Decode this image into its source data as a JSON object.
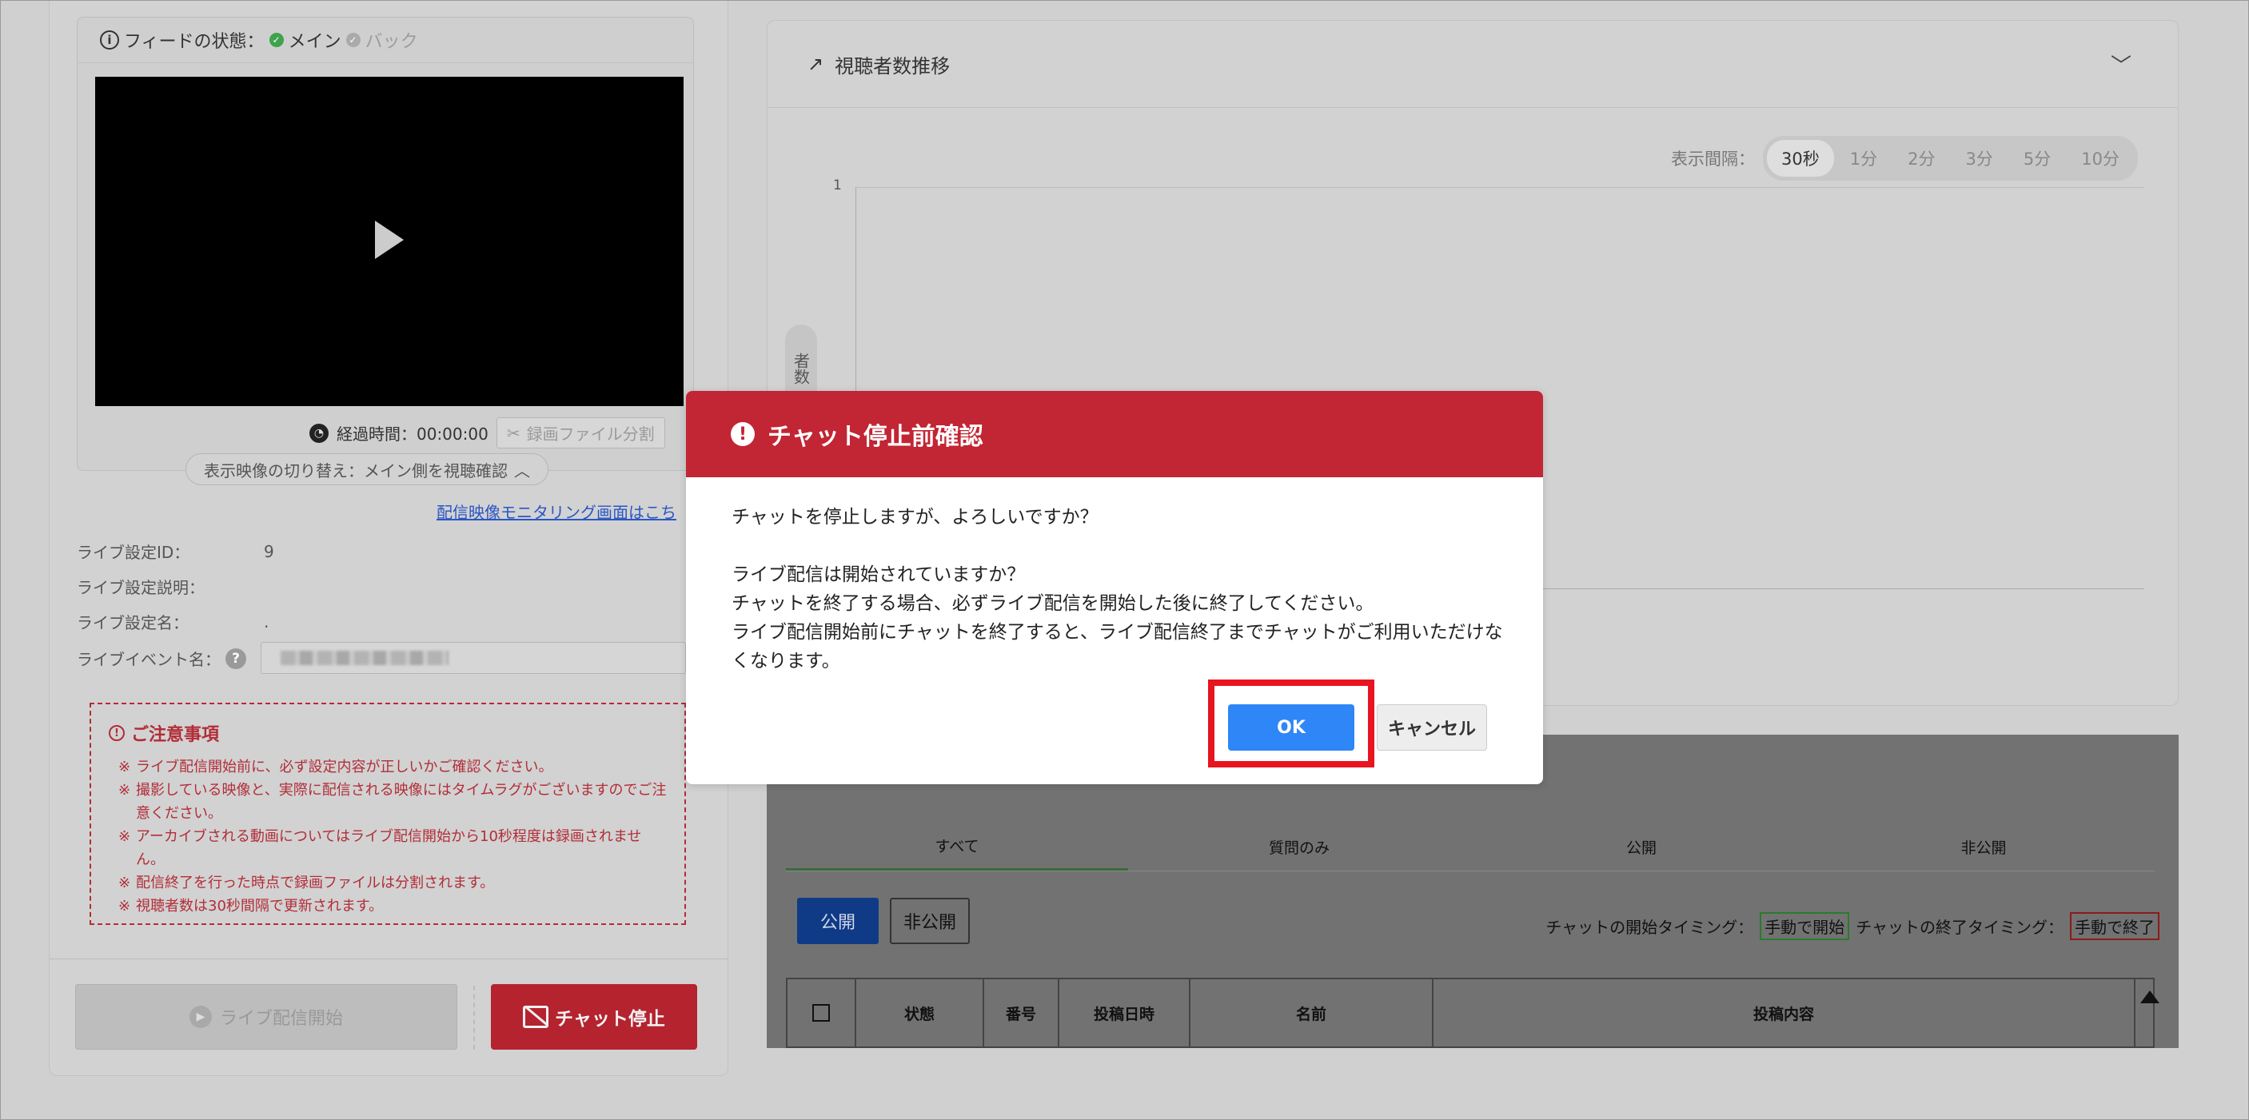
{
  "feed": {
    "label": "フィードの状態：",
    "main": "メイン",
    "backup": "バック",
    "elapsed_label": "経過時間：00:00:00",
    "split_button": "録画ファイル分割",
    "switch_label": "表示映像の切り替え：メイン側を視聴確認",
    "monitor_link": "配信映像モニタリング画面はこち"
  },
  "settings": {
    "id_label": "ライブ設定ID：",
    "id_value": "9",
    "desc_label": "ライブ設定説明：",
    "desc_value": "",
    "name_label": "ライブ設定名：",
    "name_value": ".",
    "event_label": "ライブイベント名："
  },
  "notice": {
    "title": "ご注意事項",
    "items": [
      "ライブ配信開始前に、必ず設定内容が正しいかご確認ください。",
      "撮影している映像と、実際に配信される映像にはタイムラグがございますのでご注意ください。",
      "アーカイブされる動画についてはライブ配信開始から10秒程度は録画されません。",
      "配信終了を行った時点で録画ファイルは分割されます。",
      "視聴者数は30秒間隔で更新されます。"
    ]
  },
  "actions": {
    "start_label": "ライブ配信開始",
    "stop_label": "チャット停止"
  },
  "chart": {
    "title": "視聴者数推移",
    "interval_label": "表示間隔：",
    "intervals": [
      "30秒",
      "1分",
      "2分",
      "3分",
      "5分",
      "10分"
    ],
    "active_interval": "30秒",
    "ylabel_fragment": "者数",
    "y_tick": "1"
  },
  "chart_data": {
    "type": "line",
    "title": "視聴者数推移",
    "ylabel": "者数",
    "y_ticks": [
      "1"
    ],
    "series": []
  },
  "chat": {
    "tabs": [
      "すべて",
      "質問のみ",
      "公開",
      "非公開"
    ],
    "public_button": "公開",
    "private_button": "非公開",
    "start_timing_label": "チャットの開始タイミング：",
    "start_timing_value": "手動で開始",
    "end_timing_label": "チャットの終了タイミング：",
    "end_timing_value": "手動で終了",
    "columns": [
      "状態",
      "番号",
      "投稿日時",
      "名前",
      "投稿内容"
    ]
  },
  "modal": {
    "title": "チャット停止前確認",
    "line1": "チャットを停止しますが、よろしいですか？",
    "line2": "ライブ配信は開始されていますか？",
    "line3": "チャットを終了する場合、必ずライブ配信を開始した後に終了してください。",
    "line4": "ライブ配信開始前にチャットを終了すると、ライブ配信終了までチャットがご利用いただけなくなります。",
    "ok_label": "OK",
    "cancel_label": "キャンセル"
  },
  "colors": {
    "danger": "#c22533",
    "primary": "#2f86f6",
    "highlight": "#e8141f"
  }
}
